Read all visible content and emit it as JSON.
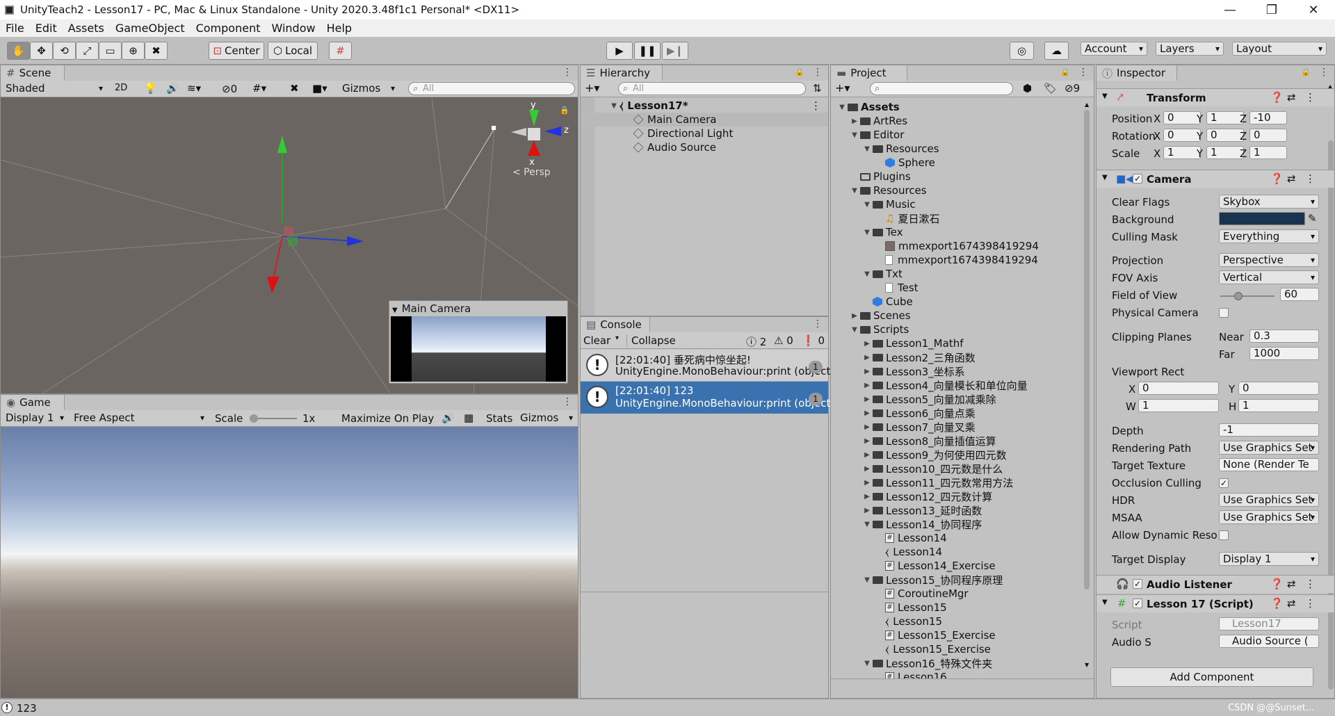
{
  "window": {
    "title": "UnityTeach2 - Lesson17 - PC, Mac & Linux Standalone - Unity 2020.3.48f1c1 Personal* <DX11>",
    "minimize": "—",
    "maximize": "❐",
    "close": "✕"
  },
  "menu": [
    "File",
    "Edit",
    "Assets",
    "GameObject",
    "Component",
    "Window",
    "Help"
  ],
  "toolbar": {
    "center": "Center",
    "local": "Local",
    "account": "Account",
    "layers": "Layers",
    "layout": "Layout"
  },
  "scene": {
    "tab": "Scene",
    "shading": "Shaded",
    "mode2d": "2D",
    "hidden_count": "0",
    "gizmos": "Gizmos",
    "search_placeholder": "All",
    "persp": "< Persp",
    "axis_y": "y",
    "axis_z": "z",
    "axis_x": "x",
    "preview_title": "Main Camera"
  },
  "game": {
    "tab": "Game",
    "display": "Display 1",
    "aspect": "Free Aspect",
    "scale_label": "Scale",
    "scale_value": "1x",
    "maximize": "Maximize On Play",
    "stats": "Stats",
    "gizmos": "Gizmos"
  },
  "hierarchy": {
    "tab": "Hierarchy",
    "search_placeholder": "All",
    "scene_name": "Lesson17*",
    "items": [
      "Main Camera",
      "Directional Light",
      "Audio Source"
    ]
  },
  "console": {
    "tab": "Console",
    "clear": "Clear",
    "collapse": "Collapse",
    "count_log": "2",
    "count_warn": "0",
    "count_err": "0",
    "entries": [
      {
        "line1": "[22:01:40] 垂死病中惊坐起!",
        "line2": "UnityEngine.MonoBehaviour:print (object)",
        "count": "1"
      },
      {
        "line1": "[22:01:40] 123",
        "line2": "UnityEngine.MonoBehaviour:print (object)",
        "count": "1"
      }
    ]
  },
  "project": {
    "tab": "Project",
    "hidden_count": "9",
    "tree": [
      {
        "label": "Assets",
        "depth": 0,
        "kind": "folder",
        "open": true,
        "bold": true
      },
      {
        "label": "ArtRes",
        "depth": 1,
        "kind": "folder"
      },
      {
        "label": "Editor",
        "depth": 1,
        "kind": "folder",
        "open": true
      },
      {
        "label": "Resources",
        "depth": 2,
        "kind": "folder",
        "open": true
      },
      {
        "label": "Sphere",
        "depth": 3,
        "kind": "cube"
      },
      {
        "label": "Plugins",
        "depth": 1,
        "kind": "folder-empty"
      },
      {
        "label": "Resources",
        "depth": 1,
        "kind": "folder",
        "open": true
      },
      {
        "label": "Music",
        "depth": 2,
        "kind": "folder",
        "open": true
      },
      {
        "label": "夏日漱石",
        "depth": 3,
        "kind": "audio"
      },
      {
        "label": "Tex",
        "depth": 2,
        "kind": "folder",
        "open": true
      },
      {
        "label": "mmexport1674398419294",
        "depth": 3,
        "kind": "image"
      },
      {
        "label": "mmexport1674398419294",
        "depth": 3,
        "kind": "file"
      },
      {
        "label": "Txt",
        "depth": 2,
        "kind": "folder",
        "open": true
      },
      {
        "label": "Test",
        "depth": 3,
        "kind": "file"
      },
      {
        "label": "Cube",
        "depth": 2,
        "kind": "cube"
      },
      {
        "label": "Scenes",
        "depth": 1,
        "kind": "folder"
      },
      {
        "label": "Scripts",
        "depth": 1,
        "kind": "folder",
        "open": true
      },
      {
        "label": "Lesson1_Mathf",
        "depth": 2,
        "kind": "folder"
      },
      {
        "label": "Lesson2_三角函数",
        "depth": 2,
        "kind": "folder"
      },
      {
        "label": "Lesson3_坐标系",
        "depth": 2,
        "kind": "folder"
      },
      {
        "label": "Lesson4_向量模长和单位向量",
        "depth": 2,
        "kind": "folder"
      },
      {
        "label": "Lesson5_向量加减乘除",
        "depth": 2,
        "kind": "folder"
      },
      {
        "label": "Lesson6_向量点乘",
        "depth": 2,
        "kind": "folder"
      },
      {
        "label": "Lesson7_向量叉乘",
        "depth": 2,
        "kind": "folder"
      },
      {
        "label": "Lesson8_向量插值运算",
        "depth": 2,
        "kind": "folder"
      },
      {
        "label": "Lesson9_为何使用四元数",
        "depth": 2,
        "kind": "folder"
      },
      {
        "label": "Lesson10_四元数是什么",
        "depth": 2,
        "kind": "folder"
      },
      {
        "label": "Lesson11_四元数常用方法",
        "depth": 2,
        "kind": "folder"
      },
      {
        "label": "Lesson12_四元数计算",
        "depth": 2,
        "kind": "folder"
      },
      {
        "label": "Lesson13_延时函数",
        "depth": 2,
        "kind": "folder"
      },
      {
        "label": "Lesson14_协同程序",
        "depth": 2,
        "kind": "folder",
        "open": true
      },
      {
        "label": "Lesson14",
        "depth": 3,
        "kind": "script"
      },
      {
        "label": "Lesson14",
        "depth": 3,
        "kind": "unity"
      },
      {
        "label": "Lesson14_Exercise",
        "depth": 3,
        "kind": "script"
      },
      {
        "label": "Lesson15_协同程序原理",
        "depth": 2,
        "kind": "folder",
        "open": true
      },
      {
        "label": "CoroutineMgr",
        "depth": 3,
        "kind": "script"
      },
      {
        "label": "Lesson15",
        "depth": 3,
        "kind": "script"
      },
      {
        "label": "Lesson15",
        "depth": 3,
        "kind": "unity"
      },
      {
        "label": "Lesson15_Exercise",
        "depth": 3,
        "kind": "script"
      },
      {
        "label": "Lesson15_Exercise",
        "depth": 3,
        "kind": "unity"
      },
      {
        "label": "Lesson16_特殊文件夹",
        "depth": 2,
        "kind": "folder",
        "open": true
      },
      {
        "label": "Lesson16",
        "depth": 3,
        "kind": "script"
      }
    ]
  },
  "inspector": {
    "tab": "Inspector",
    "transform": {
      "title": "Transform",
      "position_label": "Position",
      "rotation_label": "Rotation",
      "scale_label": "Scale",
      "position": [
        "0",
        "1",
        "-10"
      ],
      "rotation": [
        "0",
        "0",
        "0"
      ],
      "scale": [
        "1",
        "1",
        "1"
      ],
      "axes": [
        "X",
        "Y",
        "Z"
      ]
    },
    "camera": {
      "title": "Camera",
      "clear_flags_label": "Clear Flags",
      "clear_flags": "Skybox",
      "background_label": "Background",
      "background_color": "#1a3350",
      "culling_mask_label": "Culling Mask",
      "culling_mask": "Everything",
      "projection_label": "Projection",
      "projection": "Perspective",
      "fov_axis_label": "FOV Axis",
      "fov_axis": "Vertical",
      "fov_label": "Field of View",
      "fov": "60",
      "fov_fraction": 0.33,
      "physical_label": "Physical Camera",
      "clipping_label": "Clipping Planes",
      "near_label": "Near",
      "near": "0.3",
      "far_label": "Far",
      "far": "1000",
      "viewport_label": "Viewport Rect",
      "vx_label": "X",
      "vx": "0",
      "vy_label": "Y",
      "vy": "0",
      "vw_label": "W",
      "vw": "1",
      "vh_label": "H",
      "vh": "1",
      "depth_label": "Depth",
      "depth": "-1",
      "render_path_label": "Rendering Path",
      "render_path": "Use Graphics Set",
      "target_tex_label": "Target Texture",
      "target_tex": "None (Render Te",
      "occlusion_label": "Occlusion Culling",
      "hdr_label": "HDR",
      "hdr": "Use Graphics Set",
      "msaa_label": "MSAA",
      "msaa": "Use Graphics Set",
      "dyn_label": "Allow Dynamic Reso",
      "target_display_label": "Target Display",
      "target_display": "Display 1"
    },
    "audio_listener": {
      "title": "Audio Listener"
    },
    "script": {
      "title": "Lesson 17 (Script)",
      "script_label": "Script",
      "script_value": "Lesson17",
      "audio_label": "Audio S",
      "audio_value": "Audio Source (",
      "add_component": "Add Component"
    }
  },
  "status": {
    "message": "123",
    "watermark": "CSDN @@Sunset..."
  }
}
